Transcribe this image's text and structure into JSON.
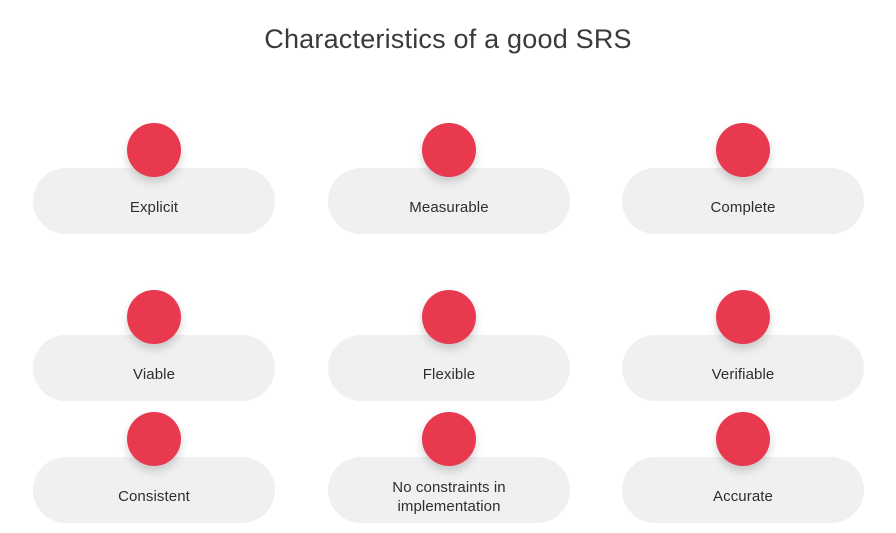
{
  "slide": {
    "title": "Characteristics of a good SRS",
    "background_color": "#ffffff",
    "accent_color": "#e8394f",
    "card_color": "#f0f0f0",
    "text_color": "#2e2e2e",
    "title_color": "#3a3a3a"
  },
  "cards": [
    {
      "label": "Explicit",
      "row": 0,
      "col": 0
    },
    {
      "label": "Measurable",
      "row": 0,
      "col": 1
    },
    {
      "label": "Complete",
      "row": 0,
      "col": 2
    },
    {
      "label": "Viable",
      "row": 1,
      "col": 0
    },
    {
      "label": "Flexible",
      "row": 1,
      "col": 1
    },
    {
      "label": "Verifiable",
      "row": 1,
      "col": 2
    },
    {
      "label": "Consistent",
      "row": 2,
      "col": 0
    },
    {
      "label": "No constraints in\nimplementation",
      "row": 2,
      "col": 1
    },
    {
      "label": "Accurate",
      "row": 2,
      "col": 2
    }
  ]
}
